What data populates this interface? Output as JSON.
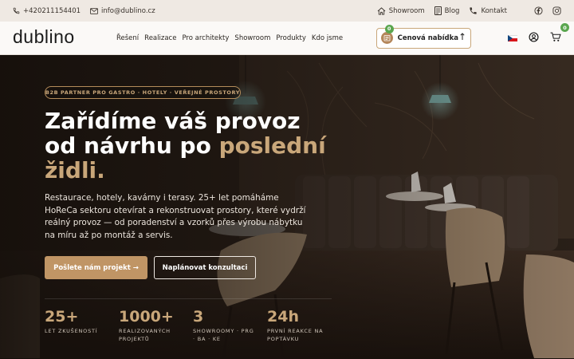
{
  "topbar": {
    "phone": "+420211154401",
    "email": "info@dublino.cz",
    "links": [
      "Showroom",
      "Blog",
      "Kontakt"
    ]
  },
  "nav": {
    "logo": "dublino",
    "menu": [
      "Řešení",
      "Realizace",
      "Pro architekty",
      "Showroom",
      "Produkty",
      "Kdo jsme"
    ],
    "quote_label": "Cenová nabídka",
    "quote_count": "0",
    "cart_count": "0"
  },
  "hero": {
    "eyebrow": "B2B PARTNER PRO GASTRO · HOTELY · VEŘEJNÉ PROSTORY",
    "title_line1": "Zařídíme váš provoz",
    "title_line2_plain": "od návrhu po ",
    "title_line2_accent": "poslední",
    "title_line3_accent": "židli.",
    "lead": "Restaurace, hotely, kavárny i terasy. 25+ let pomáháme HoReCa sektoru otevírat a rekonstruovat prostory, které vydrží reálný provoz — od poradenství a vzorků přes výrobu nábytku na míru až po montáž a servis.",
    "primary_button": "Pošlete nám projekt →",
    "secondary_button": "Naplánovat konzultaci",
    "stats": [
      {
        "value": "25+",
        "label": "LET ZKUŠENOSTÍ"
      },
      {
        "value": "1000+",
        "label": "REALIZOVANÝCH PROJEKTŮ"
      },
      {
        "value": "3",
        "label": "SHOWROOMY · PRG · BA · KE"
      },
      {
        "value": "24h",
        "label": "PRVNÍ REAKCE NA POPTÁVKU"
      }
    ]
  },
  "colors": {
    "accent": "#c9a77a",
    "button_primary": "#c09565",
    "topbar_bg": "#efe9e3",
    "hero_bg": "#1e1812",
    "badge": "#5aa64f"
  },
  "icons": [
    "phone-icon",
    "mail-icon",
    "home-icon",
    "blog-icon",
    "phone-icon",
    "facebook-icon",
    "instagram-icon",
    "quote-icon",
    "flag-cz-icon",
    "user-icon",
    "cart-icon"
  ]
}
